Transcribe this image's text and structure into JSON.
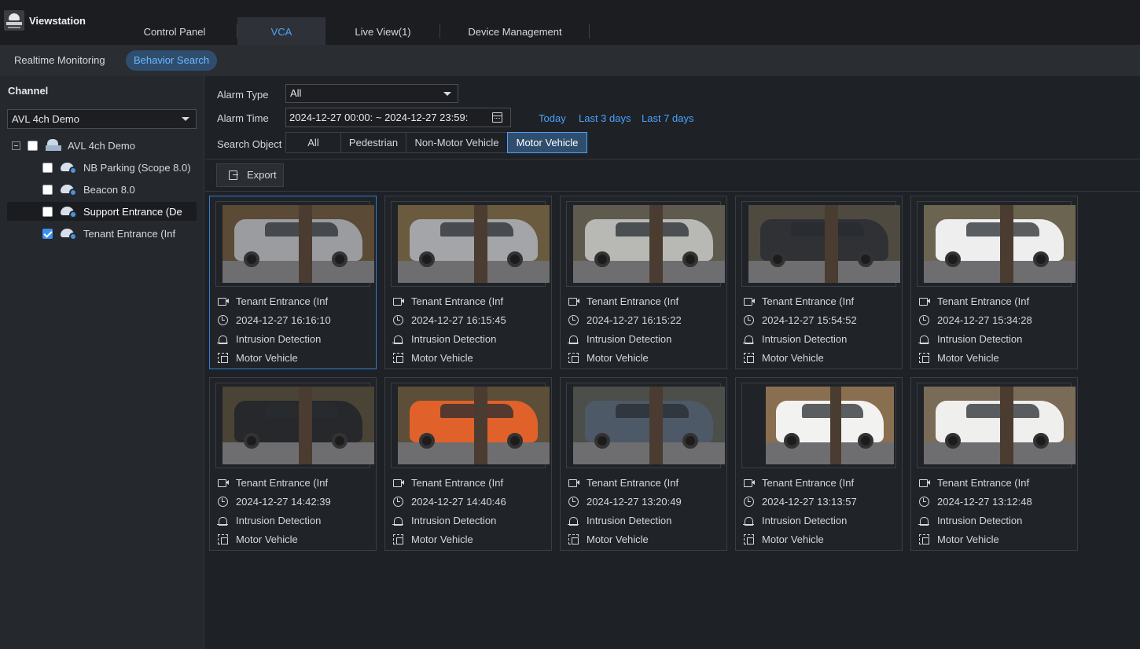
{
  "app": {
    "title": "Viewstation"
  },
  "tabs": [
    {
      "label": "Control Panel"
    },
    {
      "label": "VCA"
    },
    {
      "label": "Live View(1)"
    },
    {
      "label": "Device Management"
    }
  ],
  "subnav": {
    "realtime": "Realtime Monitoring",
    "behavior": "Behavior Search"
  },
  "sidebar": {
    "title": "Channel",
    "device_select": "AVL 4ch Demo",
    "root": "AVL 4ch Demo",
    "channels": [
      {
        "label": "NB Parking (Scope 8.0)",
        "checked": false
      },
      {
        "label": "Beacon 8.0",
        "checked": false
      },
      {
        "label": "Support Entrance (De",
        "checked": false
      },
      {
        "label": "Tenant Entrance (Inf",
        "checked": true
      }
    ]
  },
  "filters": {
    "alarm_type_label": "Alarm Type",
    "alarm_type_value": "All",
    "alarm_time_label": "Alarm Time",
    "alarm_time_value": "2024-12-27 00:00: ~  2024-12-27 23:59:",
    "quick": [
      "Today",
      "Last 3 days",
      "Last 7 days"
    ],
    "search_object_label": "Search Object",
    "objects": [
      "All",
      "Pedestrian",
      "Non-Motor Vehicle",
      "Motor Vehicle"
    ],
    "selected_object": "Motor Vehicle"
  },
  "toolbar": {
    "export_label": "Export"
  },
  "results": [
    {
      "channel": "Tenant Entrance (Inf",
      "time": "2024-12-27 16:16:10",
      "event": "Intrusion Detection",
      "object": "Motor Vehicle",
      "color": "#9a9ca0"
    },
    {
      "channel": "Tenant Entrance (Inf",
      "time": "2024-12-27 16:15:45",
      "event": "Intrusion Detection",
      "object": "Motor Vehicle",
      "color": "#a3a5a8"
    },
    {
      "channel": "Tenant Entrance (Inf",
      "time": "2024-12-27 16:15:22",
      "event": "Intrusion Detection",
      "object": "Motor Vehicle",
      "color": "#b8b8b4"
    },
    {
      "channel": "Tenant Entrance (Inf",
      "time": "2024-12-27 15:54:52",
      "event": "Intrusion Detection",
      "object": "Motor Vehicle",
      "color": "#2f3135"
    },
    {
      "channel": "Tenant Entrance (Inf",
      "time": "2024-12-27 15:34:28",
      "event": "Intrusion Detection",
      "object": "Motor Vehicle",
      "color": "#eeeeee"
    },
    {
      "channel": "Tenant Entrance (Inf",
      "time": "2024-12-27 14:42:39",
      "event": "Intrusion Detection",
      "object": "Motor Vehicle",
      "color": "#26282b"
    },
    {
      "channel": "Tenant Entrance (Inf",
      "time": "2024-12-27 14:40:46",
      "event": "Intrusion Detection",
      "object": "Motor Vehicle",
      "color": "#e0612a"
    },
    {
      "channel": "Tenant Entrance (Inf",
      "time": "2024-12-27 13:20:49",
      "event": "Intrusion Detection",
      "object": "Motor Vehicle",
      "color": "#4e5968"
    },
    {
      "channel": "Tenant Entrance (Inf",
      "time": "2024-12-27 13:13:57",
      "event": "Intrusion Detection",
      "object": "Motor Vehicle",
      "color": "#f2f2f0"
    },
    {
      "channel": "Tenant Entrance (Inf",
      "time": "2024-12-27 13:12:48",
      "event": "Intrusion Detection",
      "object": "Motor Vehicle",
      "color": "#efefed"
    }
  ],
  "colors": {
    "accent": "#4aa3ff",
    "selected_bg": "#2f4e6e",
    "background": "#1e2125"
  }
}
